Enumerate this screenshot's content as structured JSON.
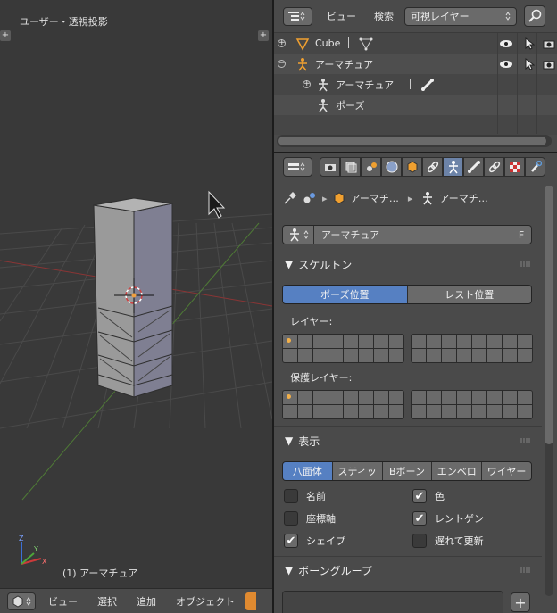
{
  "viewport": {
    "title": "ユーザー・透視投影",
    "status": "(1) アーマチュア",
    "header_items": [
      "ビュー",
      "選択",
      "追加",
      "オブジェクト"
    ]
  },
  "outliner": {
    "menu_view": "ビュー",
    "menu_search": "検索",
    "filter_select": "可視レイヤー",
    "rows": [
      {
        "label": "Cube",
        "expander": "+"
      },
      {
        "label": "アーマチュア",
        "expander": "−"
      },
      {
        "label": "アーマチュア",
        "expander": "+"
      },
      {
        "label": "ポーズ",
        "expander": ""
      }
    ]
  },
  "properties": {
    "breadcrumb": [
      "アーマチ…",
      "アーマチ…"
    ],
    "datablock_name": "アーマチュア",
    "fake_user": "F",
    "skeleton_panel": {
      "title": "スケルトン",
      "position_modes": [
        "ポーズ位置",
        "レスト位置"
      ],
      "active_mode": "ポーズ位置",
      "layers_label": "レイヤー:",
      "protected_layers_label": "保護レイヤー:"
    },
    "display_panel": {
      "title": "表示",
      "draw_types": [
        "八面体",
        "スティッ",
        "Bボーン",
        "エンベロ",
        "ワイヤー"
      ],
      "active_draw_type": "八面体",
      "options": [
        {
          "label": "名前",
          "checked": false
        },
        {
          "label": "色",
          "checked": true
        },
        {
          "label": "座標軸",
          "checked": false
        },
        {
          "label": "レントゲン",
          "checked": true
        },
        {
          "label": "シェイプ",
          "checked": true
        },
        {
          "label": "遅れて更新",
          "checked": false
        }
      ]
    },
    "bone_groups_panel": {
      "title": "ボーングループ"
    }
  },
  "colors": {
    "accent_blue": "#5680c2",
    "active_tab": "#6c83a8",
    "layer_dot": "#f2b04a",
    "x_axis": "#a03a3a",
    "y_axis": "#5f8f3a"
  }
}
